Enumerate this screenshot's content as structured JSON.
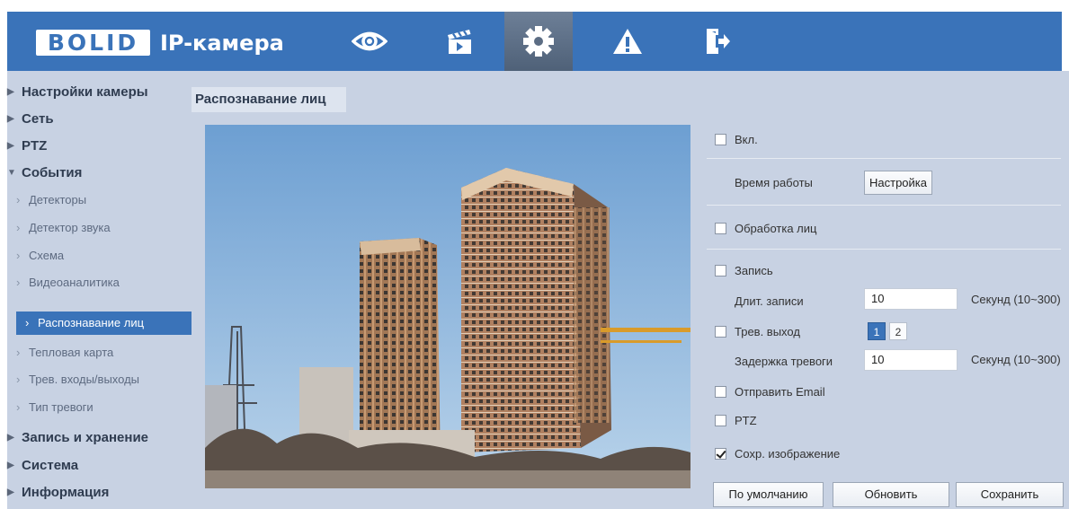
{
  "header": {
    "logo": "BOLID",
    "title": "IP-камера",
    "nav": [
      {
        "icon": "eye-icon"
      },
      {
        "icon": "clapperboard-icon"
      },
      {
        "icon": "gear-icon",
        "active": true
      },
      {
        "icon": "warning-icon"
      },
      {
        "icon": "exit-icon"
      }
    ]
  },
  "sidebar": {
    "items": [
      {
        "label": "Настройки камеры",
        "level": 1,
        "expanded": false
      },
      {
        "label": "Сеть",
        "level": 1,
        "expanded": false
      },
      {
        "label": "PTZ",
        "level": 1,
        "expanded": false
      },
      {
        "label": "События",
        "level": 1,
        "expanded": true
      },
      {
        "label": "Детекторы",
        "level": 2
      },
      {
        "label": "Детектор звука",
        "level": 2
      },
      {
        "label": "Схема",
        "level": 2
      },
      {
        "label": "Видеоаналитика",
        "level": 2
      },
      {
        "label": "Распознавание лиц",
        "level": 2,
        "selected": true
      },
      {
        "label": "Тепловая карта",
        "level": 2
      },
      {
        "label": "Трев. входы/выходы",
        "level": 2
      },
      {
        "label": "Тип тревоги",
        "level": 2
      },
      {
        "label": "Запись и хранение",
        "level": 1,
        "expanded": false
      },
      {
        "label": "Система",
        "level": 1,
        "expanded": false
      },
      {
        "label": "Информация",
        "level": 1,
        "expanded": false
      }
    ]
  },
  "page": {
    "title": "Распознавание лиц"
  },
  "settings": {
    "enable_label": "Вкл.",
    "enable_checked": false,
    "schedule_label": "Время работы",
    "schedule_button": "Настройка",
    "face_processing_label": "Обработка лиц",
    "face_processing_checked": false,
    "record_label": "Запись",
    "record_checked": false,
    "record_duration_label": "Длит. записи",
    "record_duration_value": "10",
    "record_duration_unit": "Секунд (10~300)",
    "alarm_out_label": "Трев. выход",
    "alarm_out_checked": false,
    "alarm_channels": [
      {
        "label": "1",
        "selected": true
      },
      {
        "label": "2",
        "selected": false
      }
    ],
    "alarm_delay_label": "Задержка тревоги",
    "alarm_delay_value": "10",
    "alarm_delay_unit": "Секунд (10~300)",
    "email_label": "Отправить Email",
    "email_checked": false,
    "ptz_label": "PTZ",
    "ptz_checked": false,
    "snapshot_label": "Сохр. изображение",
    "snapshot_checked": true
  },
  "footer": {
    "default_button": "По умолчанию",
    "refresh_button": "Обновить",
    "save_button": "Сохранить"
  },
  "colors": {
    "header": "#3a73b9",
    "panel": "#c8d2e3",
    "selected": "#3a73b9"
  }
}
